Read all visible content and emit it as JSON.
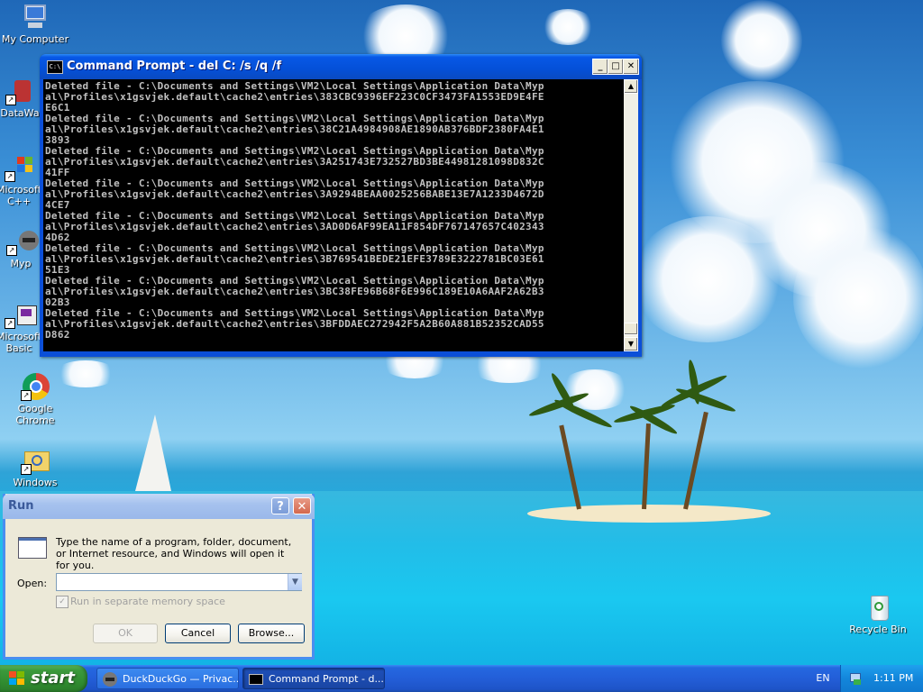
{
  "desktop": {
    "icons": [
      {
        "label": "My Computer",
        "icon": "my-computer-icon"
      },
      {
        "label": "DataWa",
        "icon": "data-icon"
      },
      {
        "label": "Microsoft C++",
        "icon": "msvc-icon"
      },
      {
        "label": "Myp",
        "icon": "raccoon-icon"
      },
      {
        "label": "Microsoft Basic",
        "icon": "msbasic-icon"
      },
      {
        "label": "Google Chrome",
        "icon": "chrome-icon"
      },
      {
        "label": "Windows",
        "icon": "windows-explorer-icon"
      },
      {
        "label": "Recycle Bin",
        "icon": "recycle-bin-icon"
      }
    ]
  },
  "cmd_window": {
    "title": "Command Prompt - del C: /s /q /f",
    "icon_label": "C:\\",
    "minimize": "_",
    "maximize": "□",
    "close": "✕",
    "lines": [
      "Deleted file - C:\\Documents and Settings\\VM2\\Local Settings\\Application Data\\Myp",
      "al\\Profiles\\x1gsvjek.default\\cache2\\entries\\383CBC9396EF223C0CF3473FA1553ED9E4FE",
      "E6C1",
      "Deleted file - C:\\Documents and Settings\\VM2\\Local Settings\\Application Data\\Myp",
      "al\\Profiles\\x1gsvjek.default\\cache2\\entries\\38C21A4984908AE1890AB376BDF2380FA4E1",
      "3893",
      "Deleted file - C:\\Documents and Settings\\VM2\\Local Settings\\Application Data\\Myp",
      "al\\Profiles\\x1gsvjek.default\\cache2\\entries\\3A251743E732527BD3BE44981281098D832C",
      "41FF",
      "Deleted file - C:\\Documents and Settings\\VM2\\Local Settings\\Application Data\\Myp",
      "al\\Profiles\\x1gsvjek.default\\cache2\\entries\\3A9294BEAA0025256BABE13E7A1233D4672D",
      "4CE7",
      "Deleted file - C:\\Documents and Settings\\VM2\\Local Settings\\Application Data\\Myp",
      "al\\Profiles\\x1gsvjek.default\\cache2\\entries\\3AD0D6AF99EA11F854DF767147657C402343",
      "4D62",
      "Deleted file - C:\\Documents and Settings\\VM2\\Local Settings\\Application Data\\Myp",
      "al\\Profiles\\x1gsvjek.default\\cache2\\entries\\3B769541BEDE21EFE3789E3222781BC03E61",
      "51E3",
      "Deleted file - C:\\Documents and Settings\\VM2\\Local Settings\\Application Data\\Myp",
      "al\\Profiles\\x1gsvjek.default\\cache2\\entries\\3BC38FE96B68F6E996C189E10A6AAF2A62B3",
      "02B3",
      "Deleted file - C:\\Documents and Settings\\VM2\\Local Settings\\Application Data\\Myp",
      "al\\Profiles\\x1gsvjek.default\\cache2\\entries\\3BFDDAEC272942F5A2B60A881B52352CAD55",
      "D862"
    ],
    "scroll_up": "▲",
    "scroll_down": "▼"
  },
  "run_dialog": {
    "title": "Run",
    "help": "?",
    "close": "✕",
    "message": "Type the name of a program, folder, document, or Internet resource, and Windows will open it for you.",
    "open_label": "Open:",
    "open_value": "",
    "dropdown": "▼",
    "checkbox_label": "Run in separate memory space",
    "checkbox_checked": true,
    "checkbox_mark": "✓",
    "ok": "OK",
    "cancel": "Cancel",
    "browse": "Browse..."
  },
  "taskbar": {
    "start": "start",
    "tasks": [
      {
        "label": "DuckDuckGo — Privac...",
        "icon": "duckduckgo-icon"
      },
      {
        "label": "Command Prompt - d...",
        "icon": "cmd-icon"
      }
    ],
    "language": "EN",
    "clock": "1:11 PM"
  }
}
